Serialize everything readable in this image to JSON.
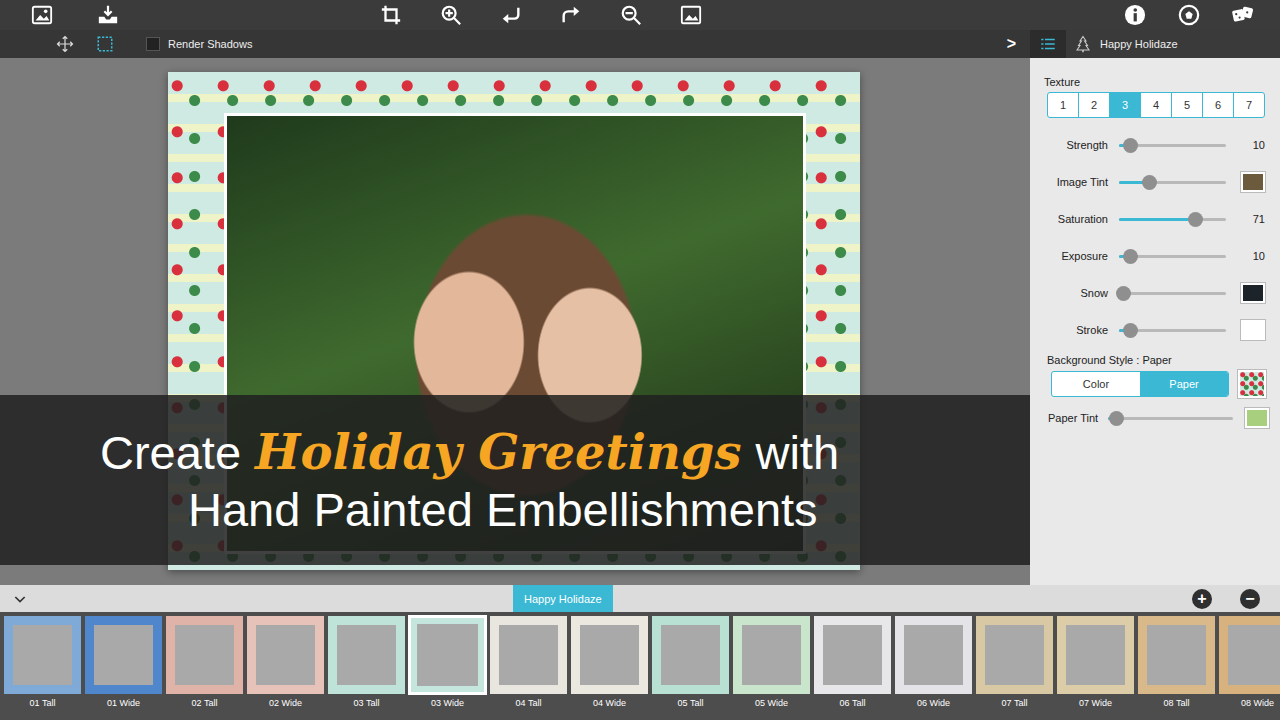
{
  "toolbar": {
    "render_shadows": {
      "label": "Render Shadows",
      "checked": false
    },
    "expand": ">"
  },
  "theme": {
    "name": "Happy Holidaze"
  },
  "panel": {
    "texture": {
      "label": "Texture",
      "options": [
        {
          "label": "1",
          "selected": false
        },
        {
          "label": "2",
          "selected": false
        },
        {
          "label": "3",
          "selected": true
        },
        {
          "label": "4",
          "selected": false
        },
        {
          "label": "5",
          "selected": false
        },
        {
          "label": "6",
          "selected": false
        },
        {
          "label": "7",
          "selected": false
        }
      ]
    },
    "controls": [
      {
        "kind": "reading",
        "label": "Strength",
        "level": 0.1,
        "reading": "10"
      },
      {
        "kind": "swatch",
        "label": "Image Tint",
        "level": 0.28,
        "color": "#6b5a3c"
      },
      {
        "kind": "reading",
        "label": "Saturation",
        "level": 0.71,
        "reading": "71"
      },
      {
        "kind": "reading",
        "label": "Exposure",
        "level": 0.1,
        "reading": "10"
      },
      {
        "kind": "swatch",
        "label": "Snow",
        "level": 0.04,
        "color": "#1c2429"
      },
      {
        "kind": "swatch",
        "label": "Stroke",
        "level": 0.1,
        "color": "#ffffff"
      }
    ],
    "background_style": {
      "label": "Background Style : Paper",
      "options": [
        {
          "label": "Color",
          "selected": false
        },
        {
          "label": "Paper",
          "selected": true
        }
      ]
    },
    "paper_tint": {
      "label": "Paper Tint",
      "level": 0.06,
      "color": "#a7cf7e"
    }
  },
  "banner": {
    "lines": [
      [
        {
          "text": "Create",
          "kind": "plain"
        },
        {
          "text": "Holiday Greetings",
          "kind": "accent"
        },
        {
          "text": "with",
          "kind": "plain"
        }
      ],
      [
        {
          "text": "Hand Painted Embellishments",
          "kind": "plain"
        }
      ]
    ]
  },
  "strip": {
    "tab": "Happy Holidaze",
    "add": "+",
    "remove": "−",
    "templates": [
      {
        "label": "01 Tall",
        "selected": false,
        "color": "#7fa9d6"
      },
      {
        "label": "01 Wide",
        "selected": false,
        "color": "#4f86cc"
      },
      {
        "label": "02 Tall",
        "selected": false,
        "color": "#e0b3a8"
      },
      {
        "label": "02 Wide",
        "selected": false,
        "color": "#e6c2b8"
      },
      {
        "label": "03 Tall",
        "selected": false,
        "color": "#bfe3d8"
      },
      {
        "label": "03 Wide",
        "selected": true,
        "color": "#c4e6dc"
      },
      {
        "label": "04 Tall",
        "selected": false,
        "color": "#e9e6df"
      },
      {
        "label": "04 Wide",
        "selected": false,
        "color": "#ebe8e0"
      },
      {
        "label": "05 Tall",
        "selected": false,
        "color": "#b8e0d3"
      },
      {
        "label": "05 Wide",
        "selected": false,
        "color": "#c9e6cc"
      },
      {
        "label": "06 Tall",
        "selected": false,
        "color": "#e7e7ea"
      },
      {
        "label": "06 Wide",
        "selected": false,
        "color": "#e4e4e8"
      },
      {
        "label": "07 Tall",
        "selected": false,
        "color": "#d8c8a4"
      },
      {
        "label": "07 Wide",
        "selected": false,
        "color": "#dccca8"
      },
      {
        "label": "08 Tall",
        "selected": false,
        "color": "#d9b98a"
      },
      {
        "label": "08 Wide",
        "selected": false,
        "color": "#d7b27e"
      }
    ]
  }
}
